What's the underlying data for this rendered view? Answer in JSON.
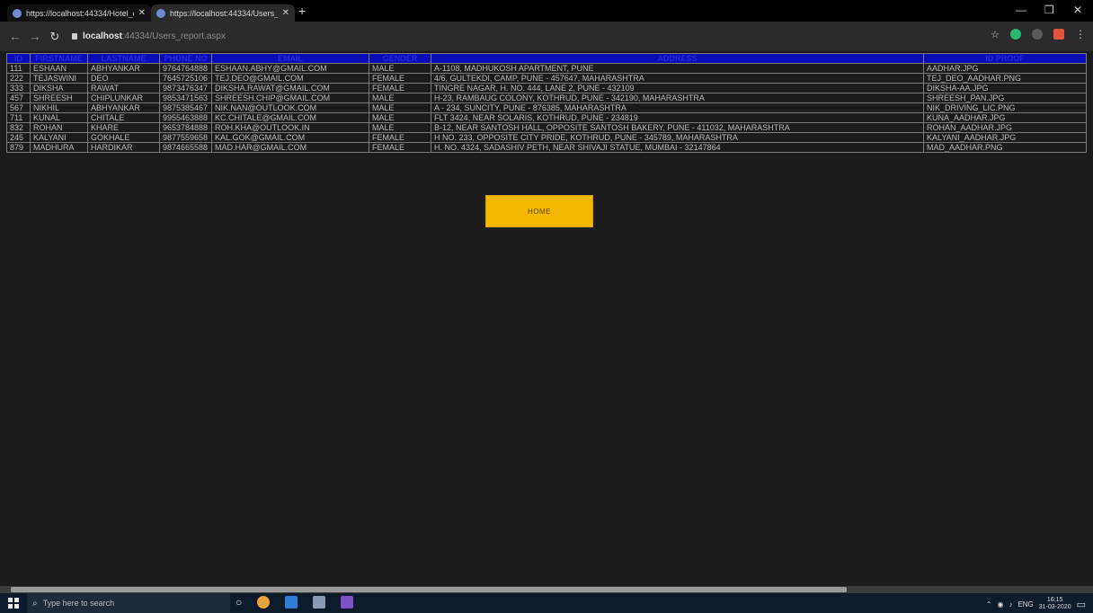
{
  "browser": {
    "tabs": [
      {
        "title": "https://localhost:44334/Hotel_o...",
        "active": false
      },
      {
        "title": "https://localhost:44334/Users_re...",
        "active": true
      }
    ],
    "new_tab_icon": "plus-icon",
    "url_host": "localhost",
    "url_path": ":44334/Users_report.aspx"
  },
  "table": {
    "headers": [
      "ID",
      "FIRSTNAME",
      "LASTNAME",
      "PHONE NO",
      "EMAIL",
      "GENDER",
      "ADDRESS",
      "ID PROOF"
    ],
    "rows": [
      [
        "111",
        "ESHAAN",
        "ABHYANKAR",
        "9764764888",
        "ESHAAN.ABHY@GMAIL.COM",
        "MALE",
        "A-1108, MADHUKOSH APARTMENT, PUNE",
        "AADHAR.JPG"
      ],
      [
        "222",
        "TEJASWINI",
        "DEO",
        "7645725106",
        "TEJ.DEO@GMAIL.COM",
        "FEMALE",
        "4/6, GULTEKDI, CAMP, PUNE - 457647, MAHARASHTRA",
        "TEJ_DEO_AADHAR.PNG"
      ],
      [
        "333",
        "DIKSHA",
        "RAWAT",
        "9873476347",
        "DIKSHA.RAWAT@GMAIL.COM",
        "FEMALE",
        "TINGRE NAGAR, H. NO. 444, LANE 2, PUNE - 432109",
        "DIKSHA-AA.JPG"
      ],
      [
        "457",
        "SHREESH",
        "CHIPLUNKAR",
        "9853471563",
        "SHREESH.CHIP@GMAIL.COM",
        "MALE",
        "H-23, RAMBAUG COLONY, KOTHRUD, PUNE - 342190, MAHARASHTRA",
        "SHREESH_PAN.JPG"
      ],
      [
        "567",
        "NIKHIL",
        "ABHYANKAR",
        "9875385467",
        "NIK.NAN@OUTLOOK.COM",
        "MALE",
        "A - 234, SUNCITY, PUNE - 876385, MAHARASHTRA",
        "NIK_DRIVING_LIC.PNG"
      ],
      [
        "711",
        "KUNAL",
        "CHITALE",
        "9955463888",
        "KC.CHITALE@GMAIL.COM",
        "MALE",
        "FLT 3424, NEAR SOLARIS, KOTHRUD, PUNE - 234819",
        "KUNA_AADHAR.JPG"
      ],
      [
        "832",
        "ROHAN",
        "KHARE",
        "9653784888",
        "ROH.KHA@OUTLOOK.IN",
        "MALE",
        "B-12, NEAR SANTOSH HALL, OPPOSITE SANTOSH BAKERY, PUNE - 411032, MAHARASHTRA",
        "ROHAN_AADHAR.JPG"
      ],
      [
        "245",
        "KALYANI",
        "GOKHALE",
        "9877559658",
        "KAL.GOK@GMAIL.COM",
        "FEMALE",
        "H NO. 233, OPPOSITE CITY PRIDE, KOTHRUD, PUNE - 345789, MAHARASHTRA",
        "KALYANI_AADHAR.JPG"
      ],
      [
        "879",
        "MADHURA",
        "HARDIKAR",
        "9874665588",
        "MAD.HAR@GMAIL.COM",
        "FEMALE",
        "H. NO. 4324, SADASHIV PETH, NEAR SHIVAJI STATUE, MUMBAI - 32147864",
        "MAD_AADHAR.PNG"
      ]
    ]
  },
  "home_button": {
    "label": "HOME"
  },
  "taskbar": {
    "search_placeholder": "Type here to search",
    "tray_language": "ENG",
    "clock_time": "16:15",
    "clock_date": "31-03-2020"
  },
  "colors": {
    "page_bg": "#1c1c1c",
    "header_bg": "#0b0bb8",
    "button_bg": "#f5b800",
    "cell_text": "#b8b8b8"
  }
}
